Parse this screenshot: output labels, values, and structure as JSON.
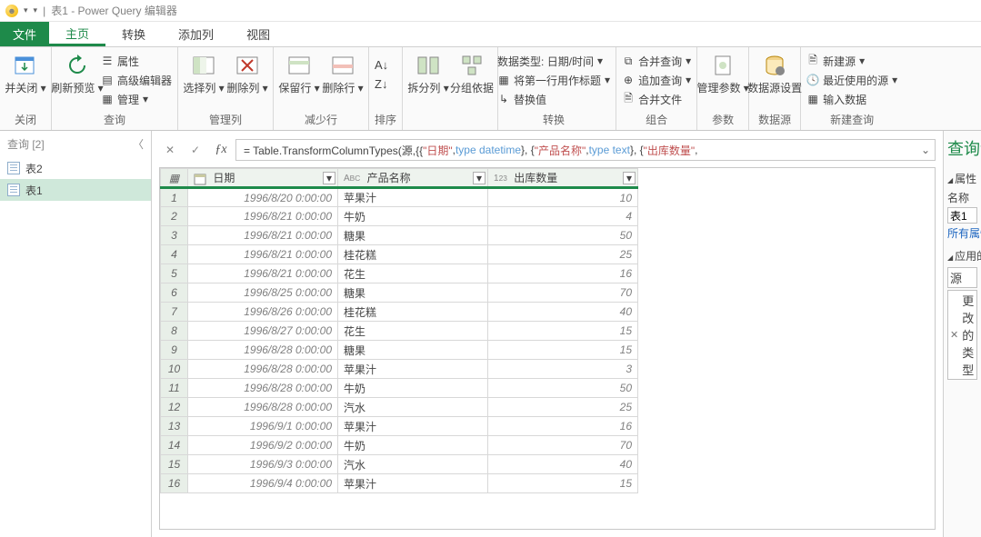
{
  "titlebar": {
    "title": "表1 - Power Query 编辑器",
    "sep": "|"
  },
  "tabs": {
    "file": "文件",
    "items": [
      "主页",
      "转换",
      "添加列",
      "视图"
    ],
    "activeIndex": 0
  },
  "ribbon": {
    "close": {
      "btn": "并关闭",
      "group": "关闭"
    },
    "query": {
      "refresh": "刷新预览",
      "props": "属性",
      "adv": "高级编辑器",
      "manage": "管理",
      "group": "查询"
    },
    "cols": {
      "choose": "选择列",
      "remove": "删除列",
      "group": "管理列"
    },
    "rows": {
      "keep": "保留行",
      "remove": "删除行",
      "group": "减少行"
    },
    "sort": {
      "group": "排序"
    },
    "split": {
      "split": "拆分列",
      "groupby": "分组依据",
      "group": ""
    },
    "trans": {
      "dtype": "数据类型: 日期/时间",
      "first": "将第一行用作标题",
      "replace": "替换值",
      "group": "转换"
    },
    "combine": {
      "merge": "合并查询",
      "append": "追加查询",
      "file": "合并文件",
      "group": "组合"
    },
    "params": {
      "btn": "管理参数",
      "group": "参数"
    },
    "ds": {
      "btn": "数据源设置",
      "group": "数据源"
    },
    "newq": {
      "new": "新建源",
      "recent": "最近使用的源",
      "input": "输入数据",
      "group": "新建查询"
    }
  },
  "queries": {
    "header": "查询 [2]",
    "items": [
      "表2",
      "表1"
    ],
    "activeIndex": 1
  },
  "formula": {
    "prefix": "= Table.TransformColumnTypes(源,{{",
    "s1": "\"日期\"",
    "p2": ", ",
    "k1": "type datetime",
    "p3": "}, {",
    "s2": "\"产品名称\"",
    "p4": ", ",
    "k2": "type text",
    "p5": "}, {",
    "s3": "\"出库数量\"",
    "p6": ","
  },
  "columns": {
    "date": "日期",
    "prod": "产品名称",
    "qty": "出库数量"
  },
  "rows": [
    {
      "n": 1,
      "d": "1996/8/20 0:00:00",
      "p": "苹果汁",
      "q": 10
    },
    {
      "n": 2,
      "d": "1996/8/21 0:00:00",
      "p": "牛奶",
      "q": 4
    },
    {
      "n": 3,
      "d": "1996/8/21 0:00:00",
      "p": "糖果",
      "q": 50
    },
    {
      "n": 4,
      "d": "1996/8/21 0:00:00",
      "p": "桂花糕",
      "q": 25
    },
    {
      "n": 5,
      "d": "1996/8/21 0:00:00",
      "p": "花生",
      "q": 16
    },
    {
      "n": 6,
      "d": "1996/8/25 0:00:00",
      "p": "糖果",
      "q": 70
    },
    {
      "n": 7,
      "d": "1996/8/26 0:00:00",
      "p": "桂花糕",
      "q": 40
    },
    {
      "n": 8,
      "d": "1996/8/27 0:00:00",
      "p": "花生",
      "q": 15
    },
    {
      "n": 9,
      "d": "1996/8/28 0:00:00",
      "p": "糖果",
      "q": 15
    },
    {
      "n": 10,
      "d": "1996/8/28 0:00:00",
      "p": "苹果汁",
      "q": 3
    },
    {
      "n": 11,
      "d": "1996/8/28 0:00:00",
      "p": "牛奶",
      "q": 50
    },
    {
      "n": 12,
      "d": "1996/8/28 0:00:00",
      "p": "汽水",
      "q": 25
    },
    {
      "n": 13,
      "d": "1996/9/1 0:00:00",
      "p": "苹果汁",
      "q": 16
    },
    {
      "n": 14,
      "d": "1996/9/2 0:00:00",
      "p": "牛奶",
      "q": 70
    },
    {
      "n": 15,
      "d": "1996/9/3 0:00:00",
      "p": "汽水",
      "q": 40
    },
    {
      "n": 16,
      "d": "1996/9/4 0:00:00",
      "p": "苹果汁",
      "q": 15
    }
  ],
  "right": {
    "title": "查询设置",
    "propSection": "属性",
    "nameLabel": "名称",
    "nameValue": "表1",
    "allProps": "所有属性",
    "stepsSection": "应用的步骤",
    "step1": "源",
    "step2": "更改的类型"
  }
}
